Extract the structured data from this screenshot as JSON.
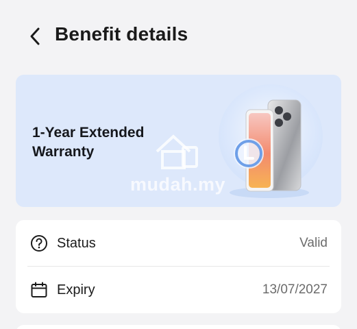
{
  "header": {
    "title": "Benefit details",
    "back_icon": "chevron-left-icon"
  },
  "banner": {
    "title": "1-Year Extended Warranty",
    "watermark": "mudah.my",
    "background": "#dde8fb"
  },
  "details": {
    "rows": [
      {
        "icon": "question-circle-icon",
        "label": "Status",
        "value": "Valid"
      },
      {
        "icon": "calendar-icon",
        "label": "Expiry",
        "value": "13/07/2027"
      }
    ]
  }
}
